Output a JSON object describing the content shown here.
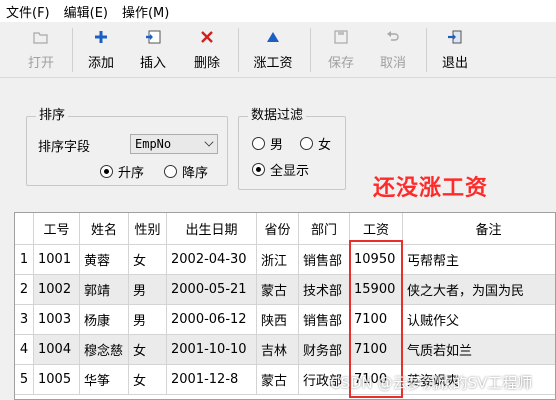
{
  "menubar": {
    "items": [
      "文件(F)",
      "编辑(E)",
      "操作(M)"
    ]
  },
  "toolbar": {
    "open": "打开",
    "add": "添加",
    "insert": "插入",
    "delete": "删除",
    "raise": "涨工资",
    "save": "保存",
    "cancel": "取消",
    "exit": "退出"
  },
  "sort": {
    "title": "排序",
    "field_label": "排序字段",
    "field_value": "EmpNo",
    "asc": "升序",
    "desc": "降序"
  },
  "filter": {
    "title": "数据过滤",
    "male": "男",
    "female": "女",
    "all": "全显示"
  },
  "annotation": "还没涨工资",
  "table": {
    "headers": [
      "工号",
      "姓名",
      "性别",
      "出生日期",
      "省份",
      "部门",
      "工资",
      "备注"
    ],
    "rows": [
      {
        "no": "1",
        "cells": [
          "1001",
          "黄蓉",
          "女",
          "2002-04-30",
          "浙江",
          "销售部",
          "10950",
          "丐帮帮主"
        ]
      },
      {
        "no": "2",
        "cells": [
          "1002",
          "郭靖",
          "男",
          "2000-05-21",
          "蒙古",
          "技术部",
          "15900",
          "侠之大者，为国为民"
        ]
      },
      {
        "no": "3",
        "cells": [
          "1003",
          "杨康",
          "男",
          "2000-06-12",
          "陕西",
          "销售部",
          "7100",
          "认贼作父"
        ]
      },
      {
        "no": "4",
        "cells": [
          "1004",
          "穆念慈",
          "女",
          "2001-10-10",
          "吉林",
          "财务部",
          "7100",
          "气质若如兰"
        ]
      },
      {
        "no": "5",
        "cells": [
          "1005",
          "华筝",
          "女",
          "2001-12-8",
          "蒙古",
          "行政部",
          "7100",
          "英姿飒爽"
        ]
      }
    ]
  },
  "watermark": "CSDN @云梦沉欣的SV工程师",
  "colors": {
    "annotation": "#ff2a2a",
    "highlight_border": "#e8302a",
    "alt_row": "#ebebeb"
  }
}
